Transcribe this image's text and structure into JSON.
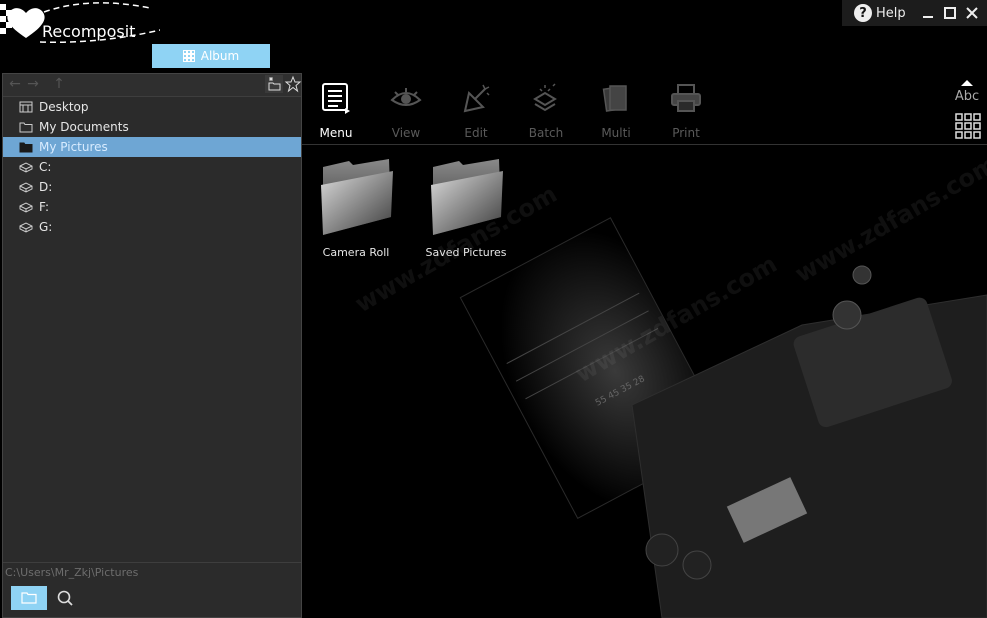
{
  "app": {
    "name": "Recomposit"
  },
  "header": {
    "album_tab": "Album",
    "help_label": "Help"
  },
  "nav": {
    "back_icon": "arrow-left-icon",
    "forward_icon": "arrow-right-icon",
    "up_icon": "up-icon"
  },
  "tree": {
    "items": [
      {
        "label": "Desktop",
        "icon": "desktop-icon"
      },
      {
        "label": "My Documents",
        "icon": "folder-icon"
      },
      {
        "label": "My Pictures",
        "icon": "folder-icon",
        "selected": true
      },
      {
        "label": "C:",
        "icon": "drive-icon"
      },
      {
        "label": "D:",
        "icon": "drive-icon"
      },
      {
        "label": "F:",
        "icon": "drive-icon"
      },
      {
        "label": "G:",
        "icon": "drive-icon"
      }
    ]
  },
  "status": {
    "path": "C:\\Users\\Mr_Zkj\\Pictures"
  },
  "toolbar": {
    "menu": "Menu",
    "view": "View",
    "edit": "Edit",
    "batch": "Batch",
    "multi": "Multi",
    "print": "Print",
    "sort_label": "Abc"
  },
  "content": {
    "folders": [
      "Camera Roll",
      "Saved Pictures"
    ]
  },
  "watermark": "www.zdfans.com",
  "colors": {
    "accent": "#8fd3f4",
    "selection": "#6ea6d4",
    "panel": "#2b2b2b",
    "background": "#000000"
  }
}
